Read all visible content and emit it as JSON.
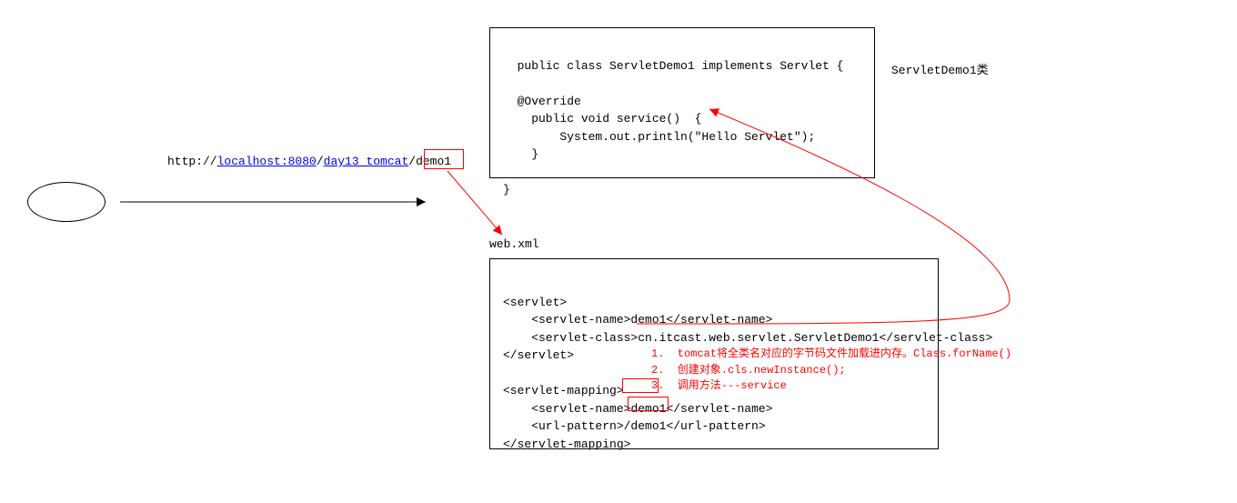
{
  "url": {
    "prefix": "http://",
    "host_link": "localhost:8080",
    "path_link": "day13_tomcat",
    "slash": "/",
    "demo": "demo1"
  },
  "servlet_code": "public class ServletDemo1 implements Servlet {\n\n  @Override\n    public void service()  {\n        System.out.println(\"Hello Servlet\");\n    }\n\n}",
  "class_label": "ServletDemo1类",
  "webxml_label": "web.xml",
  "webxml_code": {
    "line1": "<servlet>",
    "line2": "    <servlet-name>demo1</servlet-name>",
    "line3": "    <servlet-class>cn.itcast.web.servlet.ServletDemo1</servlet-class>",
    "line4": "</servlet>",
    "line5": "",
    "line6": "<servlet-mapping>",
    "line7_a": "    <servlet-name>",
    "line7_b": "demo1",
    "line7_c": "</servlet-name>",
    "line8_a": "    <url-pattern>",
    "line8_b": "/demo1",
    "line8_c": "</url-pattern>",
    "line9": "</servlet-mapping>"
  },
  "steps": {
    "s1": "1.  tomcat将全类名对应的字节码文件加载进内存。Class.forName()",
    "s2": "2.  创建对象.cls.newInstance();",
    "s3": "3.  调用方法---service"
  }
}
